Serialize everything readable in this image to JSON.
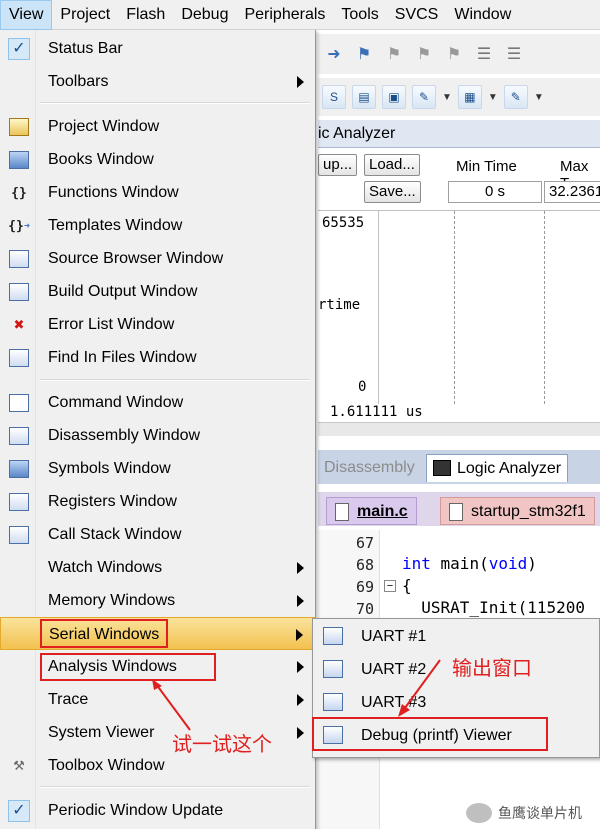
{
  "menubar": {
    "items": [
      "View",
      "Project",
      "Flash",
      "Debug",
      "Peripherals",
      "Tools",
      "SVCS",
      "Window"
    ],
    "active_index": 0
  },
  "ide": {
    "logic_analyzer_title": "ic Analyzer",
    "setup_btn": "up...",
    "load_btn": "Load...",
    "save_btn": "Save...",
    "min_time_label": "Min Time",
    "min_time_value": "0 s",
    "max_time_label": "Max T",
    "max_time_value": "32.2361",
    "plot_max": "65535",
    "plot_signal": "rtime",
    "plot_min": "0",
    "cursor_time": "1.611111 us",
    "tabs": {
      "disassembly": "Disassembly",
      "logic_analyzer": "Logic Analyzer"
    },
    "file_tabs": {
      "main": "main.c",
      "startup": "startup_stm32f1"
    },
    "code_lines": [
      {
        "num": "67",
        "text": ""
      },
      {
        "num": "68",
        "kw": "int",
        "text": " main(",
        "kw2": "void",
        "text2": ")"
      },
      {
        "num": "69",
        "text": "{"
      },
      {
        "num": "70",
        "text": "  USRAT_Init(115200"
      }
    ]
  },
  "view_menu": {
    "items": [
      {
        "label": "Status Bar",
        "icon": "check-icon",
        "checked": true
      },
      {
        "label": "Toolbars",
        "icon": "",
        "submenu": true
      },
      {
        "label": "Project Window",
        "icon": "project-window-icon"
      },
      {
        "label": "Books Window",
        "icon": "books-icon"
      },
      {
        "label": "Functions Window",
        "icon": "braces-icon"
      },
      {
        "label": "Templates Window",
        "icon": "templates-icon"
      },
      {
        "label": "Source Browser Window",
        "icon": "source-browser-icon"
      },
      {
        "label": "Build Output Window",
        "icon": "build-output-icon"
      },
      {
        "label": "Error List Window",
        "icon": "error-x-icon"
      },
      {
        "label": "Find In Files Window",
        "icon": "find-in-files-icon"
      },
      {
        "label": "Command Window",
        "icon": "command-icon"
      },
      {
        "label": "Disassembly Window",
        "icon": "disassembly-icon"
      },
      {
        "label": "Symbols Window",
        "icon": "symbols-icon"
      },
      {
        "label": "Registers Window",
        "icon": "registers-icon"
      },
      {
        "label": "Call Stack Window",
        "icon": "call-stack-icon"
      },
      {
        "label": "Watch Windows",
        "icon": "",
        "submenu": true
      },
      {
        "label": "Memory Windows",
        "icon": "",
        "submenu": true
      },
      {
        "label": "Serial Windows",
        "icon": "",
        "submenu": true,
        "highlighted": true
      },
      {
        "label": "Analysis Windows",
        "icon": "",
        "submenu": true
      },
      {
        "label": "Trace",
        "icon": "",
        "submenu": true
      },
      {
        "label": "System Viewer",
        "icon": "",
        "submenu": true
      },
      {
        "label": "Toolbox Window",
        "icon": "toolbox-icon"
      },
      {
        "label": "Periodic Window Update",
        "icon": "check-icon",
        "checked": true
      }
    ]
  },
  "serial_submenu": {
    "items": [
      "UART #1",
      "UART #2",
      "UART #3",
      "Debug (printf) Viewer"
    ]
  },
  "annotations": {
    "output_window": "输出窗口",
    "try_this": "试一试这个"
  },
  "watermark": "鱼鹰谈单片机",
  "colors": {
    "annotation_red": "#e02020",
    "highlight": "#f3c14f"
  }
}
